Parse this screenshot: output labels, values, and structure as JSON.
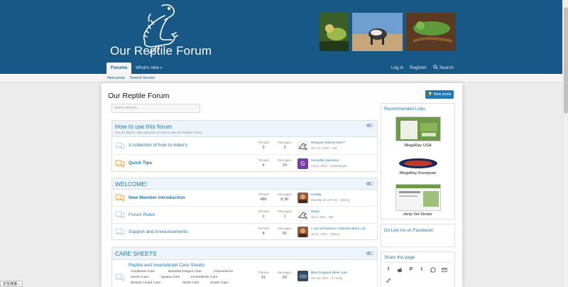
{
  "header": {
    "logo_text": "Our Reptile Forum",
    "nav": {
      "forums": "Forums",
      "whats_new": "What's new",
      "login": "Log in",
      "register": "Register",
      "search": "Search"
    },
    "subnav": {
      "new_posts": "New posts",
      "search_forums": "Search forums"
    }
  },
  "main": {
    "title": "Our Reptile Forum",
    "new_posts_button": "New posts",
    "search_placeholder": "Quick search..."
  },
  "categories": [
    {
      "title": "How to use this forum",
      "description": "How to video's, Tips and tricks on how to use Our Reptile Forum",
      "nodes": [
        {
          "title": "A collection of how to video's",
          "threads": "3",
          "messages": "3",
          "last_title": "Request Videos Here?",
          "last_meta": "Dec 22, 2020 · OM"
        },
        {
          "title": "Quick Tips",
          "threads": "4",
          "messages": "24",
          "last_title": "Humidity Question",
          "last_meta": "Aug 5, 2021 · Guitarknight",
          "avatar_letter": "G"
        }
      ]
    },
    {
      "title": "WELCOME!",
      "nodes": [
        {
          "title": "New Member Introduction",
          "threads": "486",
          "messages": "8.3K",
          "last_title": "Howdy",
          "last_meta": "Monday at 1:07 AM · Johnny"
        },
        {
          "title": "Forum Rules",
          "threads": "1",
          "messages": "1",
          "last_title": "Rules",
          "last_meta": "Jul 9, 2011 · OM"
        },
        {
          "title": "Support and Announcements",
          "threads": "8",
          "messages": "91",
          "last_title": "I can not believe I listened when I di...",
          "last_meta": "Jul 11, 2021 · Johnny"
        }
      ]
    },
    {
      "title": "CARE SHEETS",
      "nodes": [
        {
          "title": "Reptile and Invertebrate Care Sheets",
          "threads": "91",
          "messages": "93",
          "last_title": "Blue tongued skink care",
          "last_meta": "Jun 26, 2021 · AJ Kelly",
          "subforums": [
            "Amphibian Care",
            "Bearded Dragon Care",
            "Chameleons",
            "Gecko Care",
            "Iguana Care",
            "Invertebrate Care",
            "Monitor Lizard Care",
            "Skink Care",
            "Snake Care"
          ]
        }
      ]
    }
  ],
  "stat_labels": {
    "threads": "Threads",
    "messages": "Messages"
  },
  "sidebar": {
    "recommended_title": "Recommended Links",
    "links": [
      {
        "caption": "MegaRay USA"
      },
      {
        "caption": "MegaRay European"
      },
      {
        "caption": "Herp Vet Finder"
      }
    ],
    "facebook_title": "Do Like Us on Facebook!",
    "share_title": "Share this page"
  },
  "status_text": "正在连接...",
  "colors": {
    "header": "#185886",
    "accent": "#2577b1",
    "category_bg": "#edf4fa"
  }
}
